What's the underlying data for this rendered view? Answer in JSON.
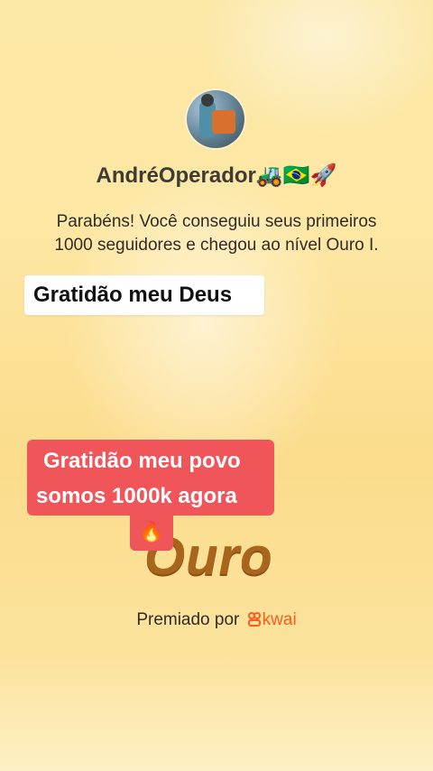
{
  "profile": {
    "username": "AndréOperador🚜🇧🇷🚀"
  },
  "message": {
    "text": "Parabéns! Você conseguiu seus primeiros 1000 seguidores e chegou ao nível Ouro I."
  },
  "captions": {
    "top": "Gratidão meu Deus",
    "middle_line1": "Gratidão meu povo",
    "middle_line2": "somos 1000k agora",
    "fire_emoji": "🔥"
  },
  "award": {
    "level": "Ouro",
    "awarded_by": "Premiado por",
    "brand": "kwai"
  },
  "colors": {
    "caption_red": "#f0555a",
    "ouro_gold": "#a9651c",
    "kwai_orange": "#ff5a1f"
  }
}
